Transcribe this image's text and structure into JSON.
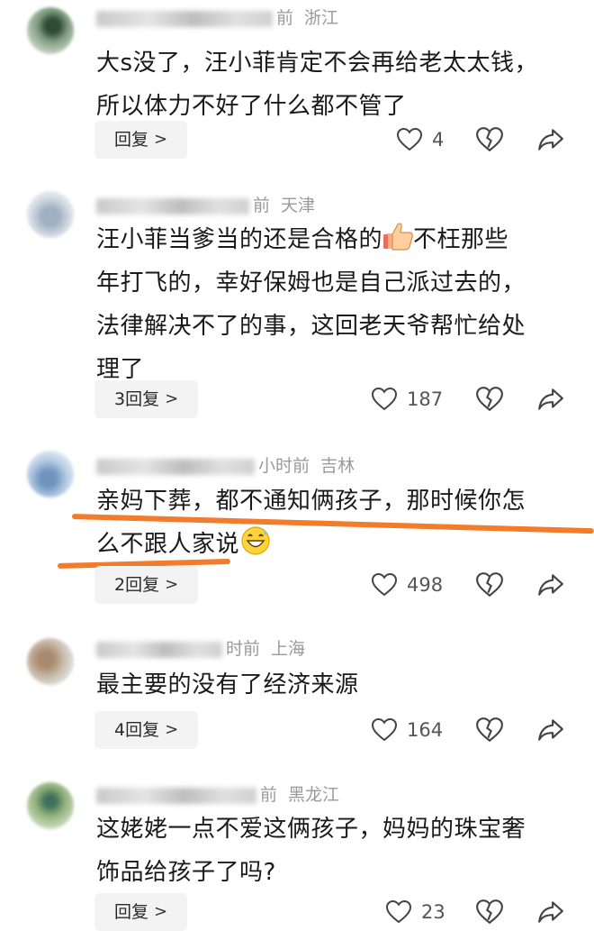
{
  "comments": [
    {
      "time": "前",
      "location": "浙江",
      "text_lines": [
        "大s没了，汪小菲肯定不会再给老太太钱，",
        "所以体力不好了什么都不管了"
      ],
      "reply_label": "回复",
      "likes": "4",
      "avatar_colors": [
        "#5f7d62",
        "#b7c9b4"
      ]
    },
    {
      "time": "前",
      "location": "天津",
      "text_lines": [
        "汪小菲当爹当的还是合格的",
        "不枉那些",
        "年打飞的，幸好保姆也是自己派过去的，",
        "法律解决不了的事，这回老天爷帮忙给处",
        "理了"
      ],
      "reply_label": "3回复",
      "likes": "187",
      "avatar_colors": [
        "#b9c6d4",
        "#e6eaee"
      ]
    },
    {
      "time": "小时前",
      "location": "吉林",
      "text_lines": [
        "亲妈下葬，都不通知俩孩子，那时候你怎",
        "么不跟人家说"
      ],
      "reply_label": "2回复",
      "likes": "498",
      "avatar_colors": [
        "#a7c0dc",
        "#eef3f8"
      ]
    },
    {
      "time": "时前",
      "location": "上海",
      "text_lines": [
        "最主要的没有了经济来源"
      ],
      "reply_label": "4回复",
      "likes": "164",
      "avatar_colors": [
        "#c9b8a3",
        "#dfe6ea"
      ]
    },
    {
      "time": "前",
      "location": "黑龙江",
      "text_lines": [
        "这姥姥一点不爱这俩孩子，妈妈的珠宝奢",
        "饰品给孩子了吗?"
      ],
      "reply_label": "回复",
      "likes": "23",
      "avatar_colors": [
        "#8fb07a",
        "#d7e4c9"
      ]
    }
  ],
  "colors": {
    "underline": "#f27b2c",
    "meta_text": "#9a9a9a",
    "reply_bg": "#f3f3f3"
  },
  "icons": {
    "like": "heart-outline-icon",
    "dislike": "broken-heart-icon",
    "share": "share-arrow-icon",
    "reply_chevron": "chevron-right-icon",
    "thumbs_up_emoji": "thumbs-up-emoji",
    "grin_emoji": "grin-sweat-emoji"
  }
}
